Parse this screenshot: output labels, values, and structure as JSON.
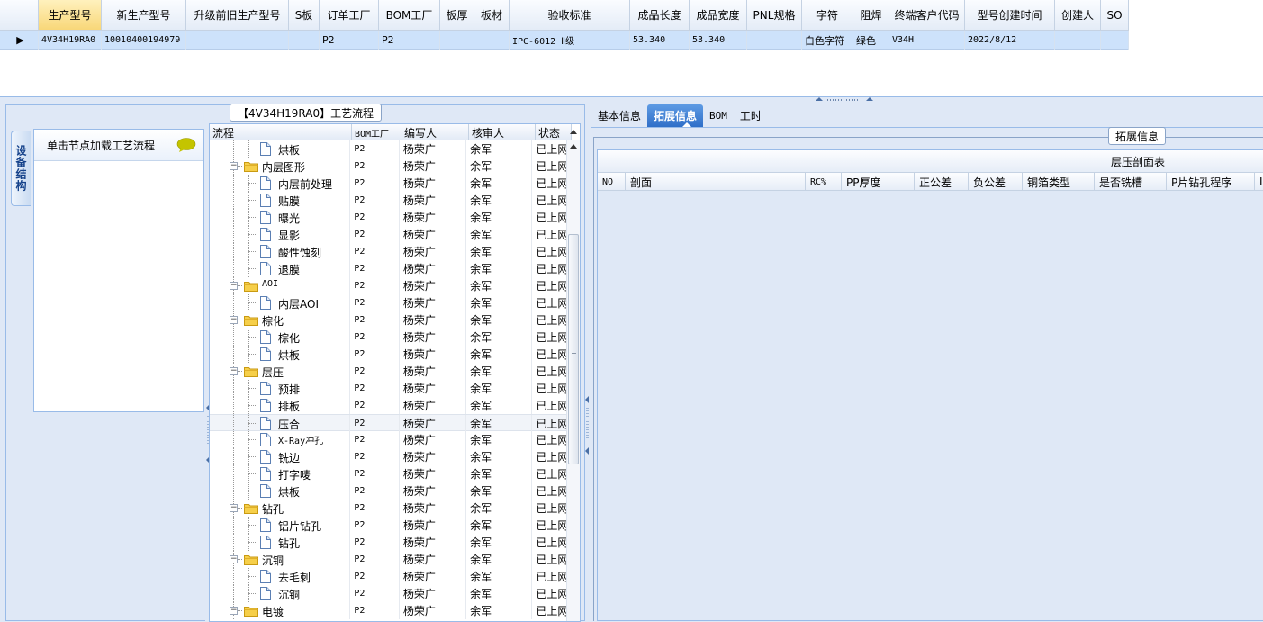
{
  "top_grid": {
    "columns": [
      "",
      "生产型号",
      "新生产型号",
      "升级前旧生产型号",
      "S板",
      "订单工厂",
      "BOM工厂",
      "板厚",
      "板材",
      "验收标准",
      "成品长度",
      "成品宽度",
      "PNL规格",
      "字符",
      "阻焊",
      "终端客户代码",
      "型号创建时间",
      "创建人",
      "SO"
    ],
    "row": [
      "▶",
      "4V34H19RA0",
      "10010400194979",
      "",
      "",
      "P2",
      "P2",
      "",
      "",
      "IPC-6012 Ⅱ级",
      "53.340",
      "53.340",
      "",
      "白色字符",
      "绿色",
      "V34H",
      "2022/8/12",
      "",
      ""
    ]
  },
  "left_panel": {
    "title": "【4V34H19RA0】工艺流程",
    "vertical_tab": "设备结构",
    "struct_button": "单击节点加载工艺流程",
    "tree": {
      "columns": [
        "流程",
        "BOM工厂",
        "编写人",
        "核审人",
        "状态"
      ],
      "rows": [
        {
          "label": "烘板",
          "type": "file",
          "level": 2,
          "bom": "P2",
          "writer": "杨荣广",
          "reviewer": "余军",
          "status": "已上网"
        },
        {
          "label": "内层图形",
          "type": "folder",
          "level": 1,
          "bom": "P2",
          "writer": "杨荣广",
          "reviewer": "余军",
          "status": "已上网"
        },
        {
          "label": "内层前处理",
          "type": "file",
          "level": 2,
          "bom": "P2",
          "writer": "杨荣广",
          "reviewer": "余军",
          "status": "已上网"
        },
        {
          "label": "贴膜",
          "type": "file",
          "level": 2,
          "bom": "P2",
          "writer": "杨荣广",
          "reviewer": "余军",
          "status": "已上网"
        },
        {
          "label": "曝光",
          "type": "file",
          "level": 2,
          "bom": "P2",
          "writer": "杨荣广",
          "reviewer": "余军",
          "status": "已上网"
        },
        {
          "label": "显影",
          "type": "file",
          "level": 2,
          "bom": "P2",
          "writer": "杨荣广",
          "reviewer": "余军",
          "status": "已上网"
        },
        {
          "label": "酸性蚀刻",
          "type": "file",
          "level": 2,
          "bom": "P2",
          "writer": "杨荣广",
          "reviewer": "余军",
          "status": "已上网"
        },
        {
          "label": "退膜",
          "type": "file",
          "level": 2,
          "bom": "P2",
          "writer": "杨荣广",
          "reviewer": "余军",
          "status": "已上网"
        },
        {
          "label": "AOI",
          "type": "folder",
          "level": 1,
          "bom": "P2",
          "writer": "杨荣广",
          "reviewer": "余军",
          "status": "已上网"
        },
        {
          "label": "内层AOI",
          "type": "file",
          "level": 2,
          "bom": "P2",
          "writer": "杨荣广",
          "reviewer": "余军",
          "status": "已上网"
        },
        {
          "label": "棕化",
          "type": "folder",
          "level": 1,
          "bom": "P2",
          "writer": "杨荣广",
          "reviewer": "余军",
          "status": "已上网"
        },
        {
          "label": "棕化",
          "type": "file",
          "level": 2,
          "bom": "P2",
          "writer": "杨荣广",
          "reviewer": "余军",
          "status": "已上网"
        },
        {
          "label": "烘板",
          "type": "file",
          "level": 2,
          "bom": "P2",
          "writer": "杨荣广",
          "reviewer": "余军",
          "status": "已上网"
        },
        {
          "label": "层压",
          "type": "folder",
          "level": 1,
          "bom": "P2",
          "writer": "杨荣广",
          "reviewer": "余军",
          "status": "已上网"
        },
        {
          "label": "预排",
          "type": "file",
          "level": 2,
          "bom": "P2",
          "writer": "杨荣广",
          "reviewer": "余军",
          "status": "已上网"
        },
        {
          "label": "排板",
          "type": "file",
          "level": 2,
          "bom": "P2",
          "writer": "杨荣广",
          "reviewer": "余军",
          "status": "已上网"
        },
        {
          "label": "压合",
          "type": "file",
          "level": 2,
          "bom": "P2",
          "writer": "杨荣广",
          "reviewer": "余军",
          "status": "已上网",
          "highlight": true
        },
        {
          "label": "X-Ray冲孔",
          "type": "file",
          "level": 2,
          "bom": "P2",
          "writer": "杨荣广",
          "reviewer": "余军",
          "status": "已上网"
        },
        {
          "label": "铣边",
          "type": "file",
          "level": 2,
          "bom": "P2",
          "writer": "杨荣广",
          "reviewer": "余军",
          "status": "已上网"
        },
        {
          "label": "打字唛",
          "type": "file",
          "level": 2,
          "bom": "P2",
          "writer": "杨荣广",
          "reviewer": "余军",
          "status": "已上网"
        },
        {
          "label": "烘板",
          "type": "file",
          "level": 2,
          "bom": "P2",
          "writer": "杨荣广",
          "reviewer": "余军",
          "status": "已上网"
        },
        {
          "label": "钻孔",
          "type": "folder",
          "level": 1,
          "bom": "P2",
          "writer": "杨荣广",
          "reviewer": "余军",
          "status": "已上网"
        },
        {
          "label": "铝片钻孔",
          "type": "file",
          "level": 2,
          "bom": "P2",
          "writer": "杨荣广",
          "reviewer": "余军",
          "status": "已上网"
        },
        {
          "label": "钻孔",
          "type": "file",
          "level": 2,
          "bom": "P2",
          "writer": "杨荣广",
          "reviewer": "余军",
          "status": "已上网"
        },
        {
          "label": "沉铜",
          "type": "folder",
          "level": 1,
          "bom": "P2",
          "writer": "杨荣广",
          "reviewer": "余军",
          "status": "已上网"
        },
        {
          "label": "去毛刺",
          "type": "file",
          "level": 2,
          "bom": "P2",
          "writer": "杨荣广",
          "reviewer": "余军",
          "status": "已上网"
        },
        {
          "label": "沉铜",
          "type": "file",
          "level": 2,
          "bom": "P2",
          "writer": "杨荣广",
          "reviewer": "余军",
          "status": "已上网"
        },
        {
          "label": "电镀",
          "type": "folder",
          "level": 1,
          "bom": "P2",
          "writer": "杨荣广",
          "reviewer": "余军",
          "status": "已上网"
        }
      ]
    }
  },
  "right_panel": {
    "tabs": [
      "基本信息",
      "拓展信息",
      "BOM",
      "工时"
    ],
    "active_tab": "拓展信息",
    "legend": "拓展信息",
    "table_title": "层压剖面表",
    "columns": [
      "NO",
      "剖面",
      "RC%",
      "PP厚度",
      "正公差",
      "负公差",
      "铜箔类型",
      "是否铣槽",
      "P片钻孔程序",
      "L"
    ]
  },
  "colors": {
    "accent": "#2f6fc8",
    "selected_header": "#f8d779",
    "selected_row": "#cde2fb",
    "panel_bg": "#dfe8f6",
    "border": "#99bbe8"
  }
}
